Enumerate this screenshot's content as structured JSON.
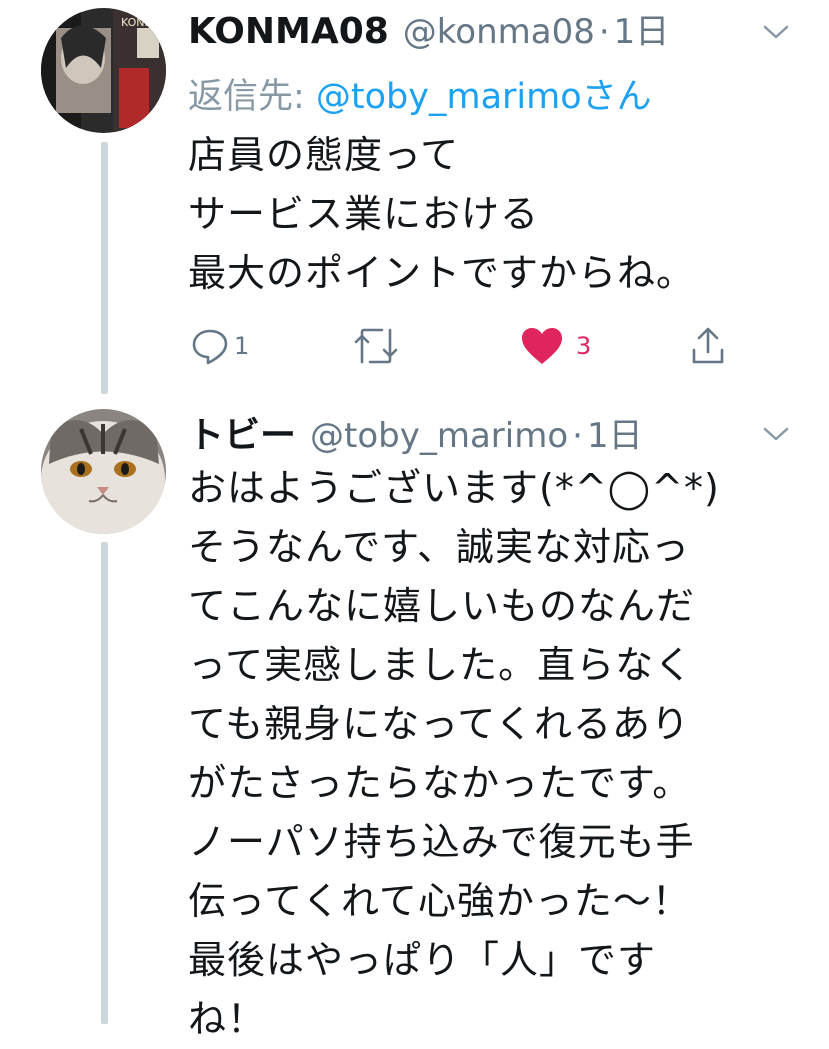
{
  "tweet1": {
    "name": "KONMA08",
    "handle": "@konma08",
    "separator": "·",
    "time": "1日",
    "reply_prefix": "返信先: ",
    "reply_mention": "@toby_marimo",
    "reply_suffix": "さん",
    "body": "店員の態度って\nサービス業における\n最大のポイントですからね。",
    "actions": {
      "reply_count": "1",
      "retweet_count": "",
      "like_count": "3"
    },
    "avatar_icon": "user-avatar-photo"
  },
  "tweet2": {
    "name": "トビー",
    "handle": "@toby_marimo",
    "separator": "·",
    "time": "1日",
    "body": "おはようございます(*^◯^*)\nそうなんです、誠実な対応っ\nてこんなに嬉しいものなんだ\nって実感しました。直らなく\nても親身になってくれるあり\nがたさったらなかったです。\nノーパソ持ち込みで復元も手\n伝ってくれて心強かった〜！\n最後はやっぱり「人」です\nね！",
    "avatar_icon": "cat-avatar-photo"
  },
  "colors": {
    "text": "#14171a",
    "secondary": "#657786",
    "link": "#1da1f2",
    "like": "#e0245e",
    "thread_line": "#ccd6dd"
  }
}
